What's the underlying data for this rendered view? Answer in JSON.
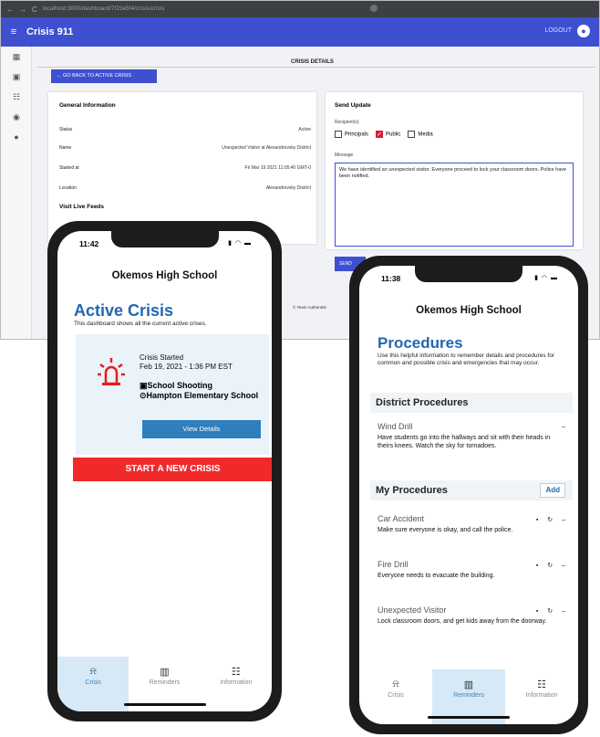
{
  "browser": {
    "url": "localhost:3000/dashboard/7f23e5f4/crisis/crisis"
  },
  "app": {
    "title": "Crisis 911",
    "logout": "LOGOUT"
  },
  "details": {
    "heading": "CRISIS DETAILS",
    "go_back": "← GO BACK TO ACTIVE CRISIS",
    "general": {
      "title": "General Information",
      "rows": [
        {
          "label": "Status",
          "value": "Active"
        },
        {
          "label": "Name",
          "value": "Unexpected Visitor at Alexandrovsky District"
        },
        {
          "label": "Started at",
          "value": "Fri Mar 19 2021 11:05:40 GMT-0"
        },
        {
          "label": "Location",
          "value": "Alexandrovsky District"
        }
      ],
      "live_feeds": "Visit Live Feeds"
    },
    "send_update": {
      "title": "Send Update",
      "recipients_label": "Recipient(s)",
      "recipients": [
        {
          "label": "Principals",
          "checked": false
        },
        {
          "label": "Public",
          "checked": true
        },
        {
          "label": "Media",
          "checked": false
        }
      ],
      "message_label": "Message",
      "message": "We have identified an unexpected visitor. Everyone proceed to lock your classroom doors. Police have been notified.",
      "send": "SEND"
    },
    "footer": "© Team Authentek"
  },
  "phone1": {
    "time": "11:42",
    "school": "Okemos High School",
    "title": "Active Crisis",
    "desc": "This dashboard shows all the current active crises.",
    "card": {
      "started_label": "Crisis Started",
      "started_value": "Feb 19, 2021 - 1:36 PM EST",
      "type": "School Shooting",
      "location": "Hampton Elementary School",
      "view": "View Details"
    },
    "start_new": "START A NEW CRISIS",
    "tabs": [
      "Crisis",
      "Reminders",
      "Information"
    ]
  },
  "phone2": {
    "time": "11:38",
    "school": "Okemos High School",
    "title": "Procedures",
    "desc": "Use this helpful information to remember details and procedures for common and possible crisis and emergencies that may occur.",
    "district_heading": "District Procedures",
    "district_items": [
      {
        "title": "Wind Drill",
        "desc": "Have students go into the hallways and sit with their heads in theirs knees. Watch the sky for tornadoes."
      }
    ],
    "my_heading": "My Procedures",
    "add": "Add",
    "my_items": [
      {
        "title": "Car Accident",
        "desc": "Make sure everyone is okay, and call the police."
      },
      {
        "title": "Fire Drill",
        "desc": "Everyone needs to evacuate the building."
      },
      {
        "title": "Unexpected Visitor",
        "desc": "Lock classroom doors, and get kids away from the doorway."
      }
    ],
    "tabs": [
      "Crisis",
      "Reminders",
      "Information"
    ]
  },
  "colors": {
    "primary": "#3e4fd0",
    "accent_blue": "#2467b0",
    "danger": "#f02a2a",
    "tab_active": "#d7e9f6"
  }
}
